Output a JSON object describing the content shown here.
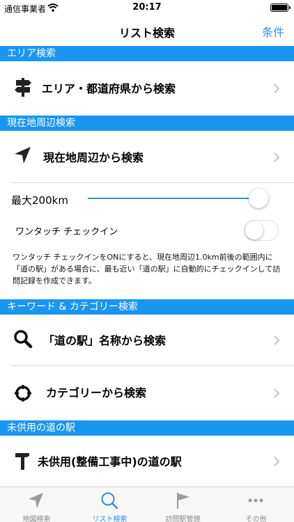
{
  "status_bar": {
    "carrier": "通信事業者",
    "time": "20:17"
  },
  "nav": {
    "title": "リスト検索",
    "filter_label": "条件"
  },
  "sections": {
    "area": {
      "header": "エリア検索",
      "row_label": "エリア・都道府県から検索"
    },
    "nearby": {
      "header": "現在地周辺検索",
      "row_label": "現在地周辺から検索",
      "max_distance_label": "最大200km",
      "max_distance_value": 200,
      "checkin_label": "ワンタッチ チェックイン",
      "checkin_enabled": false,
      "description": "ワンタッチ チェックインをONにすると、現在地周辺1.0km前後の範囲内に「道の駅」がある場合に、最も近い「道の駅」に自動的にチェックインして訪問記録を作成できます。"
    },
    "keyword": {
      "header": "キーワード & カテゴリー検索",
      "name_row_label": "「道の駅」名称から検索",
      "category_row_label": "カテゴリーから検索"
    },
    "unopened": {
      "header": "未供用の道の駅",
      "row_label": "未供用(整備工事中)の道の駅"
    }
  },
  "tabs": [
    {
      "label": "地図検索",
      "icon": "location-arrow-icon",
      "active": false
    },
    {
      "label": "リスト検索",
      "icon": "search-icon",
      "active": true
    },
    {
      "label": "訪問駅管理",
      "icon": "flag-icon",
      "active": false
    },
    {
      "label": "その他",
      "icon": "more-icon",
      "active": false
    }
  ],
  "colors": {
    "accent": "#2f8fe6",
    "section_header": "#1a96f0",
    "inactive_tab": "#8a8a8a"
  }
}
